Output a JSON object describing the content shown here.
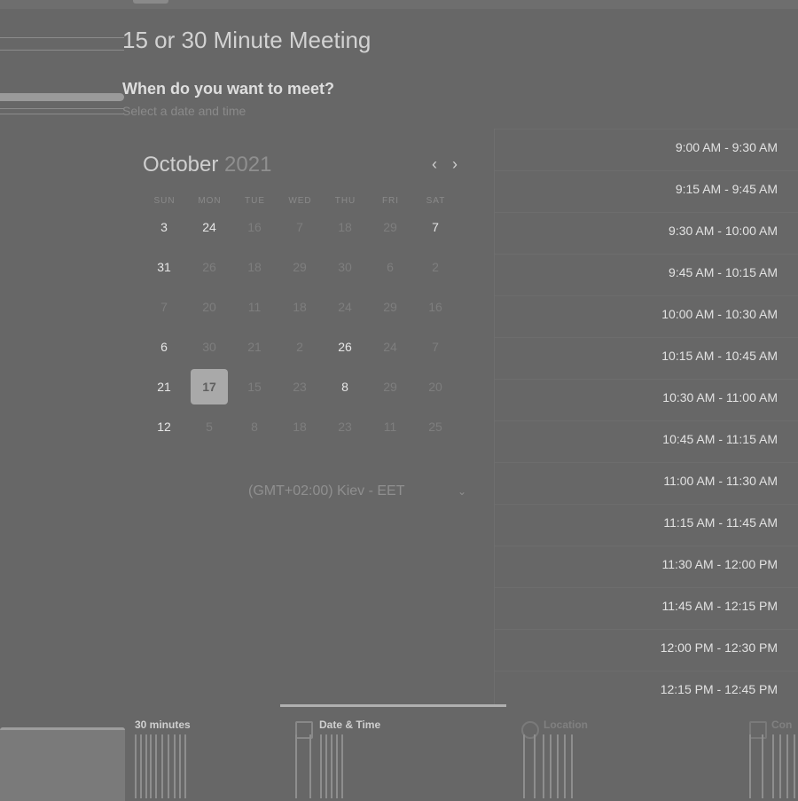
{
  "page": {
    "title": "15 or 30 Minute Meeting",
    "subtitle": "When do you want to meet?",
    "hint": "Select a date and time"
  },
  "calendar": {
    "month": "October",
    "year": "2021",
    "prev_icon": "chevron-left-icon",
    "next_icon": "chevron-right-icon",
    "weekdays": [
      "SUN",
      "MON",
      "TUE",
      "WED",
      "THU",
      "FRI",
      "SAT"
    ],
    "rows": [
      [
        "3",
        "24",
        "16",
        "7",
        "18",
        "29",
        "7"
      ],
      [
        "31",
        "26",
        "18",
        "29",
        "30",
        "6",
        "2"
      ],
      [
        "7",
        "20",
        "11",
        "18",
        "24",
        "29",
        "16"
      ],
      [
        "6",
        "30",
        "21",
        "2",
        "26",
        "24",
        "7"
      ],
      [
        "21",
        "17",
        "15",
        "23",
        "8",
        "29",
        "20"
      ],
      [
        "12",
        "5",
        "8",
        "18",
        "23",
        "11",
        "25"
      ]
    ],
    "available": [
      [
        0,
        0
      ],
      [
        0,
        1
      ],
      [
        0,
        6
      ],
      [
        1,
        0
      ],
      [
        3,
        0
      ],
      [
        3,
        4
      ],
      [
        4,
        0
      ],
      [
        4,
        4
      ],
      [
        5,
        0
      ]
    ],
    "selected": [
      4,
      1
    ]
  },
  "timezone": {
    "label": "(GMT+02:00) Kiev - EET",
    "icon": "chevron-down-icon"
  },
  "time_slots": [
    "9:00 AM - 9:30 AM",
    "9:15 AM - 9:45 AM",
    "9:30 AM - 10:00 AM",
    "9:45 AM - 10:15 AM",
    "10:00 AM - 10:30 AM",
    "10:15 AM - 10:45 AM",
    "10:30 AM - 11:00 AM",
    "10:45 AM - 11:15 AM",
    "11:00 AM - 11:30 AM",
    "11:15 AM - 11:45 AM",
    "11:30 AM - 12:00 PM",
    "11:45 AM - 12:15 PM",
    "12:00 PM - 12:30 PM",
    "12:15 PM - 12:45 PM"
  ],
  "bottom_tabs": [
    {
      "label": "30 minutes",
      "icon": "",
      "dim": false
    },
    {
      "label": "Date & Time",
      "icon": "calendar-icon",
      "dim": false
    },
    {
      "label": "Location",
      "icon": "location-pin-icon",
      "dim": true
    },
    {
      "label": "Con",
      "icon": "confirm-icon",
      "dim": true
    }
  ]
}
